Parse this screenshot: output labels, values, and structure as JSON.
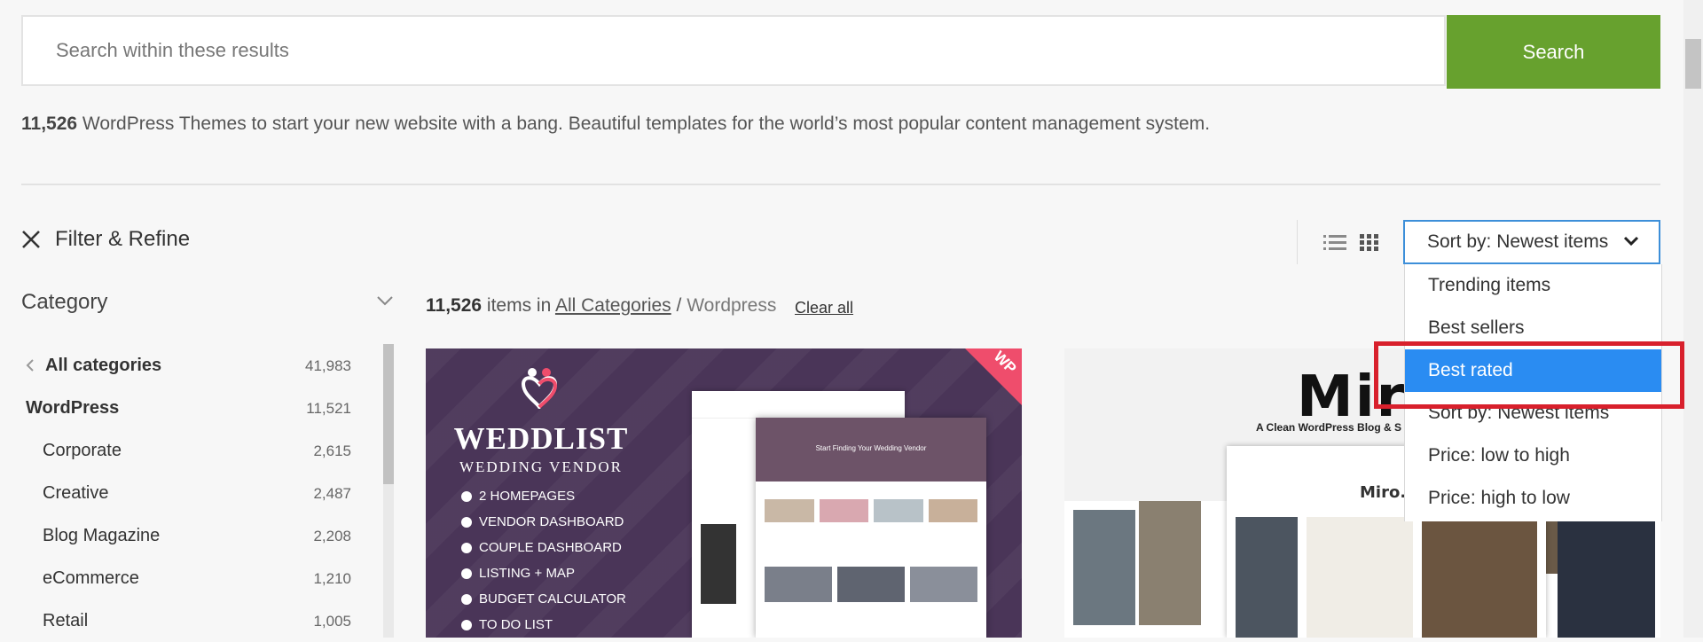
{
  "search": {
    "placeholder": "Search within these results",
    "button_label": "Search"
  },
  "intro": {
    "count": "11,526",
    "text": " WordPress Themes to start your new website with a bang.  Beautiful templates for the world’s most popular content management system."
  },
  "filter": {
    "label": "Filter & Refine"
  },
  "sort": {
    "current": "Sort by: Newest items",
    "options": [
      "Trending items",
      "Best sellers",
      "Best rated",
      "Sort by: Newest items",
      "Price: low to high",
      "Price: high to low"
    ],
    "active_index": 2
  },
  "category": {
    "title": "Category",
    "items": [
      {
        "label": "All categories",
        "count": "41,983"
      },
      {
        "label": "WordPress",
        "count": "11,521"
      },
      {
        "label": "Corporate",
        "count": "2,615"
      },
      {
        "label": "Creative",
        "count": "2,487"
      },
      {
        "label": "Blog Magazine",
        "count": "2,208"
      },
      {
        "label": "eCommerce",
        "count": "1,210"
      },
      {
        "label": "Retail",
        "count": "1,005"
      }
    ]
  },
  "results": {
    "count": "11,526",
    "items_in": " items in ",
    "all_categories": "All Categories",
    "separator": " / ",
    "current": "Wordpress",
    "clear_all": "Clear all"
  },
  "cards": [
    {
      "badge": "WP",
      "title": "WEDDLIST",
      "subtitle": "WEDDING VENDOR",
      "features": [
        "2 HOMEPAGES",
        "VENDOR DASHBOARD",
        "COUPLE DASHBOARD",
        "LISTING + MAP",
        "BUDGET CALCULATOR",
        "TO DO LIST"
      ],
      "hero_text": "Start Finding Your Wedding Vendor"
    },
    {
      "title": "Miro",
      "tagline": "A Clean WordPress Blog & S",
      "inner_logo": "Miro."
    }
  ],
  "colors": {
    "accent_green": "#67a12e",
    "sort_border": "#3d8fd9",
    "active_option": "#2a8cf2",
    "highlight": "#d8202c"
  }
}
